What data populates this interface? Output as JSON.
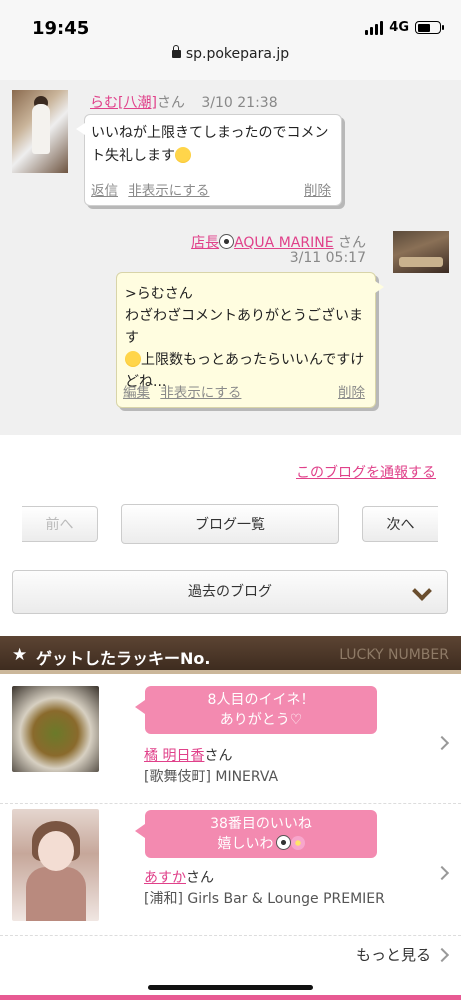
{
  "status_bar": {
    "time": "19:45",
    "network": "4G",
    "url": "sp.pokepara.jp"
  },
  "comments": [
    {
      "author": "らむ[八潮]",
      "honorific": "さん",
      "date": "3/10 21:38",
      "text": "いいねが上限きてしまったのでコメント失礼します",
      "emoji": "hugging-face-emoji",
      "actions": {
        "reply": "返信",
        "hide": "非表示にする",
        "delete": "削除"
      }
    },
    {
      "author_prefix": "店長",
      "author": "AQUA MARINE",
      "honorific": "さん",
      "date": "3/11 05:17",
      "text_lines": [
        ">らむさん",
        "わざわざコメントありがとうございます",
        "上限数もっとあったらいいんですけどね..."
      ],
      "emoji": "smiling-face-emoji",
      "actions": {
        "edit": "編集",
        "hide": "非表示にする",
        "delete": "削除"
      }
    }
  ],
  "report_link": "このブログを通報する",
  "nav": {
    "prev": "前へ",
    "list": "ブログ一覧",
    "next": "次へ"
  },
  "past_blog": {
    "selected": "過去のブログ"
  },
  "lucky": {
    "title": "ゲットしたラッキーNo.",
    "title_en": "LUCKY NUMBER",
    "items": [
      {
        "message_line1": "8人目のイイネ！",
        "message_line2": "ありがとう♡",
        "name": "橘 明日香",
        "honorific": "さん",
        "shop": "[歌舞伎町] MINERVA"
      },
      {
        "message_line1": "38番目のいいね",
        "message_line2": "嬉しいわ",
        "name": "あすか",
        "honorific": "さん",
        "shop": "[浦和] Girls Bar & Lounge PREMIER"
      }
    ],
    "more": "もっと見る"
  },
  "colors": {
    "accent_pink": "#e0418a",
    "bubble_pink": "#f38ab0",
    "header_brown": "#4e3828"
  }
}
